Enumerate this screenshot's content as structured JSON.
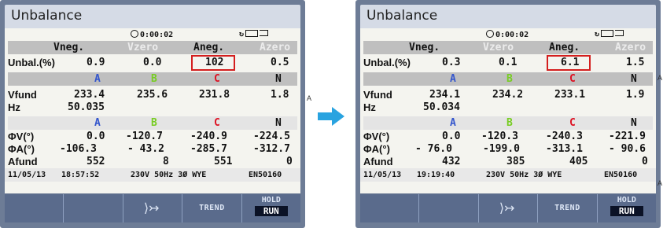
{
  "colors": {
    "frame": "#6d7c96",
    "screen": "#f4f4ef",
    "phase_A": "#3355cc",
    "phase_B": "#77cc22",
    "phase_C": "#dd1122",
    "highlight": "#d41e1e",
    "arrow": "#29a3e0"
  },
  "panels": [
    {
      "title": "Unbalance",
      "status": {
        "clock": "0:00:02"
      },
      "header1": [
        "Vneg.",
        "Vzero",
        "Aneg.",
        "Azero"
      ],
      "unbal": {
        "label": "Unbal.(%)",
        "values": [
          "0.9",
          "0.0",
          "102",
          "0.5"
        ]
      },
      "phase_row1": [
        "A",
        "B",
        "C",
        "N"
      ],
      "vfund": {
        "label": "Vfund",
        "values": [
          "233.4",
          "235.6",
          "231.8",
          "1.8"
        ]
      },
      "hz": {
        "label": "Hz",
        "value": "50.035"
      },
      "phase_row2": [
        "A",
        "B",
        "C",
        "N"
      ],
      "phiv": {
        "label": "ΦV(°)",
        "values": [
          "0.0",
          "-120.7",
          "-240.9",
          "-224.5"
        ]
      },
      "phia": {
        "label": "ΦA(°)",
        "values": [
          "-106.3",
          "- 43.2",
          "-285.7",
          "-312.7"
        ]
      },
      "afund": {
        "label": "Afund",
        "values": [
          "552",
          "8",
          "551",
          "0"
        ]
      },
      "footer": {
        "date": "11/05/13",
        "time": "18:57:52",
        "config": "230V  50Hz 3Ø WYE",
        "standard": "EN50160"
      },
      "softkeys": {
        "trend": "TREND",
        "hold": "HOLD",
        "run": "RUN"
      }
    },
    {
      "title": "Unbalance",
      "status": {
        "clock": "0:00:02"
      },
      "header1": [
        "Vneg.",
        "Vzero",
        "Aneg.",
        "Azero"
      ],
      "unbal": {
        "label": "Unbal.(%)",
        "values": [
          "0.3",
          "0.1",
          "6.1",
          "1.5"
        ]
      },
      "phase_row1": [
        "A",
        "B",
        "C",
        "N"
      ],
      "vfund": {
        "label": "Vfund",
        "values": [
          "234.1",
          "234.2",
          "233.1",
          "1.9"
        ]
      },
      "hz": {
        "label": "Hz",
        "value": "50.034"
      },
      "phase_row2": [
        "A",
        "B",
        "C",
        "N"
      ],
      "phiv": {
        "label": "ΦV(°)",
        "values": [
          "0.0",
          "-120.3",
          "-240.3",
          "-221.9"
        ]
      },
      "phia": {
        "label": "ΦA(°)",
        "values": [
          "- 76.0",
          "-199.0",
          "-313.1",
          "- 90.6"
        ]
      },
      "afund": {
        "label": "Afund",
        "values": [
          "432",
          "385",
          "405",
          "0"
        ]
      },
      "footer": {
        "date": "11/05/13",
        "time": "19:19:40",
        "config": "230V  50Hz 3Ø WYE",
        "standard": "EN50160"
      },
      "softkeys": {
        "trend": "TREND",
        "hold": "HOLD",
        "run": "RUN"
      }
    }
  ],
  "edge_marks": [
    "A",
    "A",
    "A"
  ]
}
